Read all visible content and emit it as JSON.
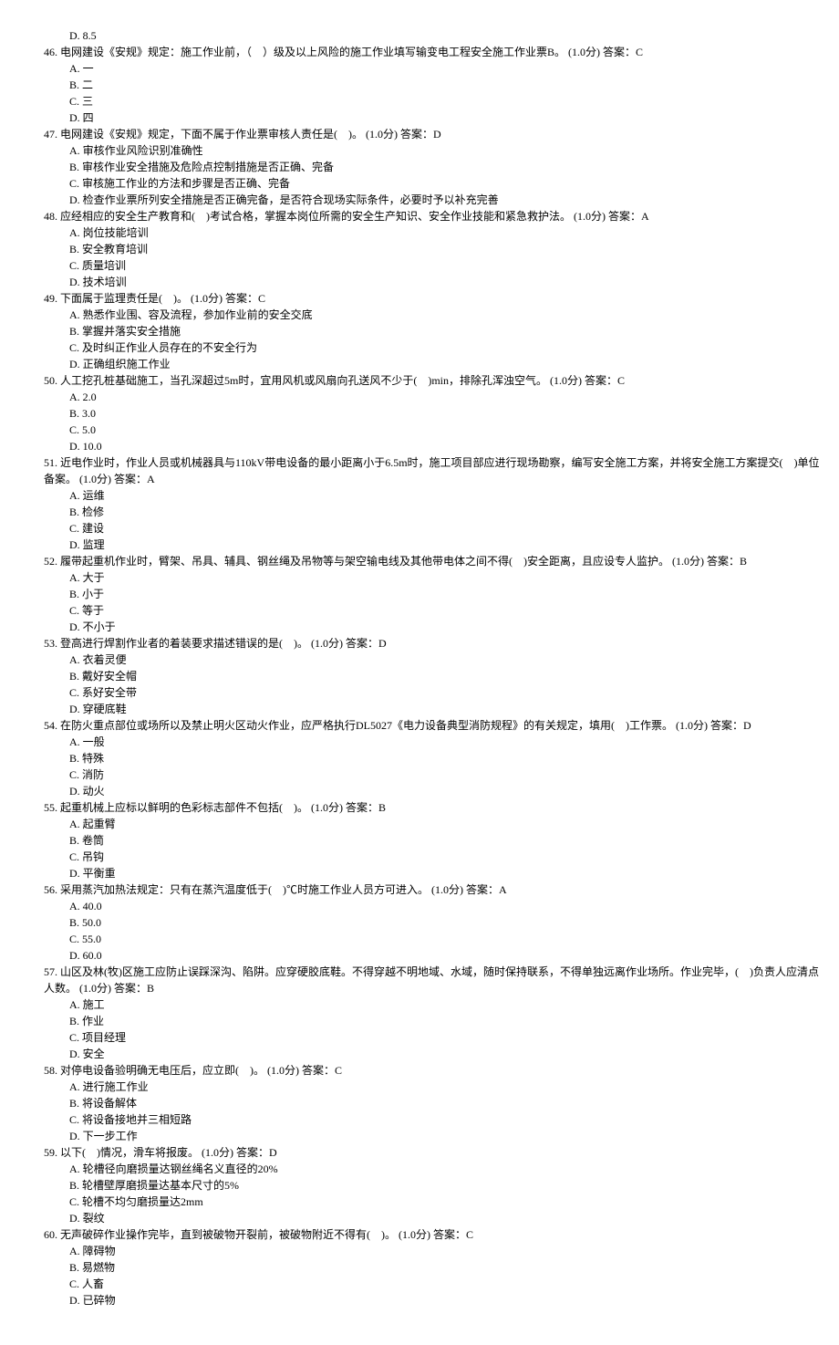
{
  "stray": {
    "label": "D",
    "text": "8.5"
  },
  "questions": [
    {
      "num": "46",
      "text": "电网建设《安规》规定：施工作业前，（　）级及以上风险的施工作业填写输变电工程安全施工作业票B。",
      "points": "(1.0分)",
      "answer_label": "答案：",
      "answer": "C",
      "options": [
        {
          "label": "A",
          "text": "一"
        },
        {
          "label": "B",
          "text": "二"
        },
        {
          "label": "C",
          "text": "三"
        },
        {
          "label": "D",
          "text": "四"
        }
      ]
    },
    {
      "num": "47",
      "text": "电网建设《安规》规定，下面不属于作业票审核人责任是(　)。",
      "points": "(1.0分)",
      "answer_label": "答案：",
      "answer": "D",
      "options": [
        {
          "label": "A",
          "text": "审核作业风险识别准确性"
        },
        {
          "label": "B",
          "text": "审核作业安全措施及危险点控制措施是否正确、完备"
        },
        {
          "label": "C",
          "text": "审核施工作业的方法和步骤是否正确、完备"
        },
        {
          "label": "D",
          "text": "检查作业票所列安全措施是否正确完备，是否符合现场实际条件，必要时予以补充完善"
        }
      ]
    },
    {
      "num": "48",
      "text": "应经相应的安全生产教育和(　)考试合格，掌握本岗位所需的安全生产知识、安全作业技能和紧急救护法。",
      "points": "(1.0分)",
      "answer_label": "答案：",
      "answer": "A",
      "options": [
        {
          "label": "A",
          "text": "岗位技能培训"
        },
        {
          "label": "B",
          "text": "安全教育培训"
        },
        {
          "label": "C",
          "text": "质量培训"
        },
        {
          "label": "D",
          "text": "技术培训"
        }
      ]
    },
    {
      "num": "49",
      "text": "下面属于监理责任是(　)。",
      "points": "(1.0分)",
      "answer_label": "答案：",
      "answer": "C",
      "options": [
        {
          "label": "A",
          "text": "熟悉作业围、容及流程，参加作业前的安全交底"
        },
        {
          "label": "B",
          "text": "掌握并落实安全措施"
        },
        {
          "label": "C",
          "text": "及时纠正作业人员存在的不安全行为"
        },
        {
          "label": "D",
          "text": "正确组织施工作业"
        }
      ]
    },
    {
      "num": "50",
      "text": "人工挖孔桩基础施工，当孔深超过5m时，宜用风机或风扇向孔送风不少于(　)min，排除孔浑浊空气。",
      "points": "(1.0分)",
      "answer_label": "答案：",
      "answer": "C",
      "options": [
        {
          "label": "A",
          "text": "2.0"
        },
        {
          "label": "B",
          "text": "3.0"
        },
        {
          "label": "C",
          "text": "5.0"
        },
        {
          "label": "D",
          "text": "10.0"
        }
      ]
    },
    {
      "num": "51",
      "text": "近电作业时，作业人员或机械器具与110kV带电设备的最小距离小于6.5m时，施工项目部应进行现场勘察，编写安全施工方案，并将安全施工方案提交(　)单位备案。",
      "points": "(1.0分)",
      "answer_label": "答案：",
      "answer": "A",
      "options": [
        {
          "label": "A",
          "text": "运维"
        },
        {
          "label": "B",
          "text": "检修"
        },
        {
          "label": "C",
          "text": "建设"
        },
        {
          "label": "D",
          "text": "监理"
        }
      ]
    },
    {
      "num": "52",
      "text": "履带起重机作业时，臂架、吊具、辅具、钢丝绳及吊物等与架空输电线及其他带电体之间不得(　)安全距离，且应设专人监护。",
      "points": "(1.0分)",
      "answer_label": "答案：",
      "answer": "B",
      "options": [
        {
          "label": "A",
          "text": "大于"
        },
        {
          "label": "B",
          "text": "小于"
        },
        {
          "label": "C",
          "text": "等于"
        },
        {
          "label": "D",
          "text": "不小于"
        }
      ]
    },
    {
      "num": "53",
      "text": "登高进行焊割作业者的着装要求描述错误的是(　)。",
      "points": "(1.0分)",
      "answer_label": "答案：",
      "answer": "D",
      "options": [
        {
          "label": "A",
          "text": "衣着灵便"
        },
        {
          "label": "B",
          "text": "戴好安全帽"
        },
        {
          "label": "C",
          "text": "系好安全带"
        },
        {
          "label": "D",
          "text": "穿硬底鞋"
        }
      ]
    },
    {
      "num": "54",
      "text": "在防火重点部位或场所以及禁止明火区动火作业，应严格执行DL5027《电力设备典型消防规程》的有关规定，填用(　)工作票。",
      "points": "(1.0分)",
      "answer_label": "答案：",
      "answer": "D",
      "options": [
        {
          "label": "A",
          "text": "一般"
        },
        {
          "label": "B",
          "text": "特殊"
        },
        {
          "label": "C",
          "text": "消防"
        },
        {
          "label": "D",
          "text": "动火"
        }
      ]
    },
    {
      "num": "55",
      "text": "起重机械上应标以鲜明的色彩标志部件不包括(　)。",
      "points": "(1.0分)",
      "answer_label": "答案：",
      "answer": "B",
      "options": [
        {
          "label": "A",
          "text": "起重臂"
        },
        {
          "label": "B",
          "text": "卷筒"
        },
        {
          "label": "C",
          "text": "吊钩"
        },
        {
          "label": "D",
          "text": "平衡重"
        }
      ]
    },
    {
      "num": "56",
      "text": "采用蒸汽加热法规定：只有在蒸汽温度低于(　)℃时施工作业人员方可进入。",
      "points": "(1.0分)",
      "answer_label": "答案：",
      "answer": "A",
      "options": [
        {
          "label": "A",
          "text": "40.0"
        },
        {
          "label": "B",
          "text": "50.0"
        },
        {
          "label": "C",
          "text": "55.0"
        },
        {
          "label": "D",
          "text": "60.0"
        }
      ]
    },
    {
      "num": "57",
      "text": "山区及林(牧)区施工应防止误踩深沟、陷阱。应穿硬胶底鞋。不得穿越不明地域、水域，随时保持联系，不得单独远离作业场所。作业完毕，(　)负责人应清点人数。",
      "points": "(1.0分)",
      "answer_label": "答案：",
      "answer": "B",
      "options": [
        {
          "label": "A",
          "text": "施工"
        },
        {
          "label": "B",
          "text": "作业"
        },
        {
          "label": "C",
          "text": "项目经理"
        },
        {
          "label": "D",
          "text": "安全"
        }
      ]
    },
    {
      "num": "58",
      "text": "对停电设备验明确无电压后，应立即(　)。",
      "points": "(1.0分)",
      "answer_label": "答案：",
      "answer": "C",
      "options": [
        {
          "label": "A",
          "text": "进行施工作业"
        },
        {
          "label": "B",
          "text": "将设备解体"
        },
        {
          "label": "C",
          "text": "将设备接地并三相短路"
        },
        {
          "label": "D",
          "text": "下一步工作"
        }
      ]
    },
    {
      "num": "59",
      "text": "以下(　)情况，滑车将报废。",
      "points": "(1.0分)",
      "answer_label": "答案：",
      "answer": "D",
      "options": [
        {
          "label": "A",
          "text": "轮槽径向磨损量达钢丝绳名义直径的20%"
        },
        {
          "label": "B",
          "text": "轮槽壁厚磨损量达基本尺寸的5%"
        },
        {
          "label": "C",
          "text": "轮槽不均匀磨损量达2mm"
        },
        {
          "label": "D",
          "text": "裂纹"
        }
      ]
    },
    {
      "num": "60",
      "text": "无声破碎作业操作完毕，直到被破物开裂前，被破物附近不得有(　)。",
      "points": "(1.0分)",
      "answer_label": "答案：",
      "answer": "C",
      "options": [
        {
          "label": "A",
          "text": "障碍物"
        },
        {
          "label": "B",
          "text": "易燃物"
        },
        {
          "label": "C",
          "text": "人畜"
        },
        {
          "label": "D",
          "text": "已碎物"
        }
      ]
    }
  ]
}
